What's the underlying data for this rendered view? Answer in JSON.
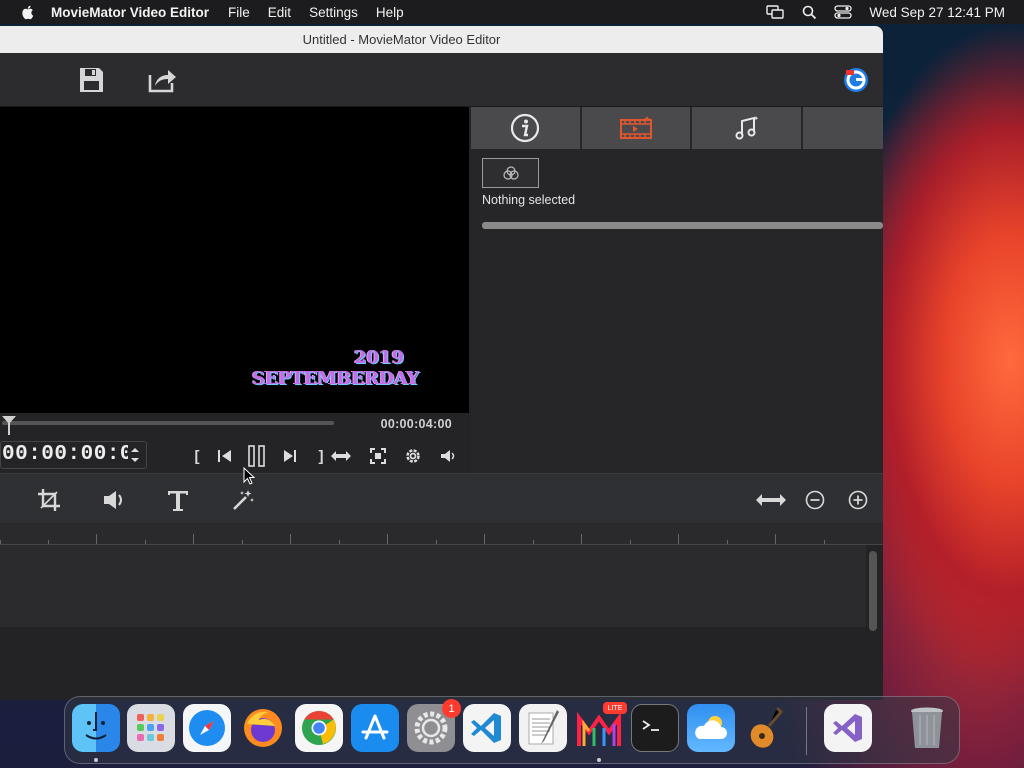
{
  "menubar": {
    "app_name": "MovieMator Video Editor",
    "menus": [
      "File",
      "Edit",
      "Settings",
      "Help"
    ],
    "clock": "Wed Sep 27  12:41 PM"
  },
  "window": {
    "title": "Untitled - MovieMator Video Editor"
  },
  "preview": {
    "overlay_year": "2019",
    "overlay_text": "SEPTEMBERDAY",
    "duration": "00:00:04:00",
    "timecode": "00:00:00:00"
  },
  "transport": {
    "mark_in": "[",
    "mark_out": "]"
  },
  "panel": {
    "status": "Nothing selected"
  },
  "dock": {
    "settings_badge": "1",
    "pdf_lite_label": "LITE"
  },
  "colors": {
    "accent": "#e2562e",
    "panel_tab": "#4a4a4d"
  }
}
